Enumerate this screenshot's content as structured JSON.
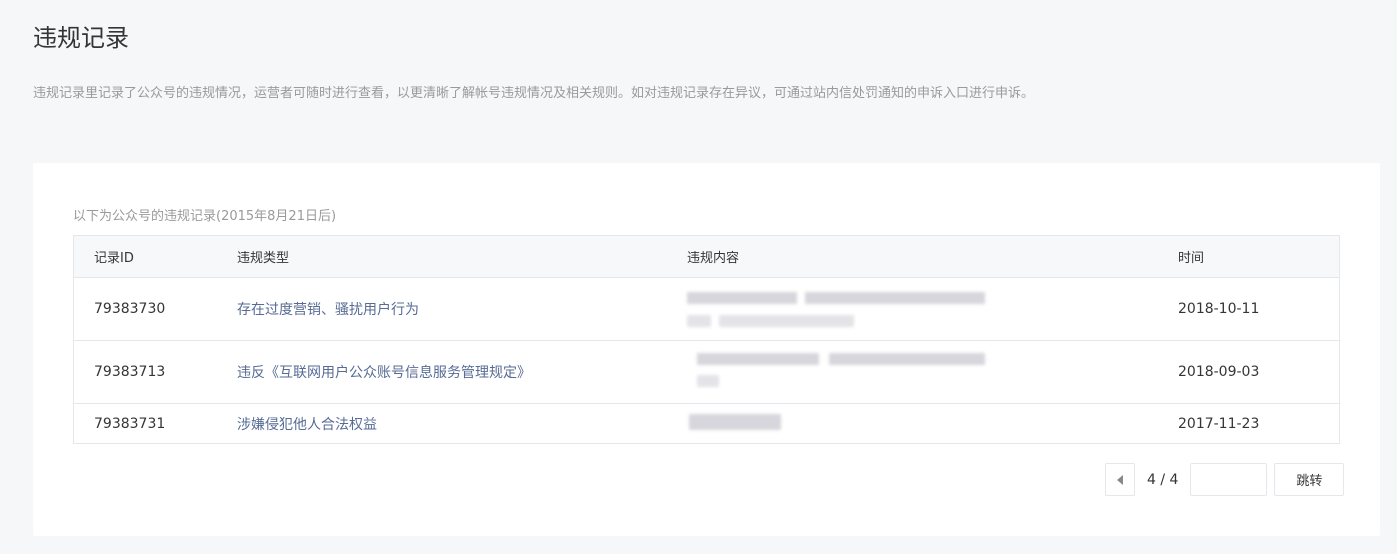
{
  "page": {
    "title": "违规记录",
    "description": "违规记录里记录了公众号的违规情况，运营者可随时进行查看，以更清晰了解帐号违规情况及相关规则。如对违规记录存在异议，可通过站内信处罚通知的申诉入口进行申诉。"
  },
  "records": {
    "caption": "以下为公众号的违规记录(2015年8月21日后)",
    "headers": {
      "id": "记录ID",
      "type": "违规类型",
      "content": "违规内容",
      "time": "时间"
    },
    "rows": [
      {
        "id": "79383730",
        "type": "存在过度营销、骚扰用户行为",
        "content": "[blurred]",
        "time": "2018-10-11"
      },
      {
        "id": "79383713",
        "type": "违反《互联网用户公众账号信息服务管理规定》",
        "content": "[blurred]",
        "time": "2018-09-03"
      },
      {
        "id": "79383731",
        "type": "涉嫌侵犯他人合法权益",
        "content": "[blurred]",
        "time": "2017-11-23"
      }
    ]
  },
  "pagination": {
    "page_label": "4 / 4",
    "input_value": "",
    "input_placeholder": "",
    "jump_label": "跳转"
  },
  "colors": {
    "background": "#f6f7f9",
    "card": "#ffffff",
    "link": "#576b95",
    "muted_text": "#9a9a9a",
    "border": "#e4e8eb"
  }
}
